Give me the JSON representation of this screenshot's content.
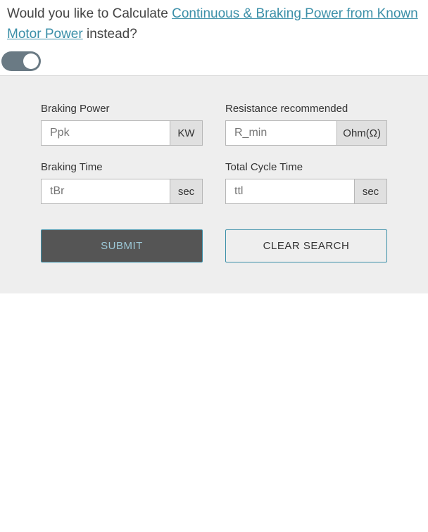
{
  "prompt": {
    "prefix": "Would you like to Calculate ",
    "link": "Continuous & Braking Power from Known Motor Power",
    "suffix": " instead?"
  },
  "toggle": {
    "on": true
  },
  "fields": {
    "brakingPower": {
      "label": "Braking Power",
      "placeholder": "Ppk",
      "unit": "KW",
      "value": ""
    },
    "resistance": {
      "label": "Resistance recommended",
      "placeholder": "R_min",
      "unit": "Ohm(Ω)",
      "value": ""
    },
    "brakingTime": {
      "label": "Braking Time",
      "placeholder": "tBr",
      "unit": "sec",
      "value": ""
    },
    "cycleTime": {
      "label": "Total Cycle Time",
      "placeholder": "ttl",
      "unit": "sec",
      "value": ""
    }
  },
  "buttons": {
    "submit": "SUBMIT",
    "clear": "CLEAR SEARCH"
  }
}
